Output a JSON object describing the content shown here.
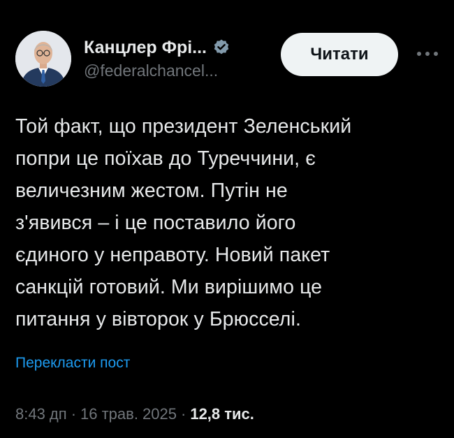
{
  "author": {
    "display_name": "Канцлер Фрі...",
    "handle": "@federalchancel...",
    "verified_icon": "verified-badge-icon",
    "avatar_icon": "profile-photo"
  },
  "actions": {
    "follow_label": "Читати",
    "more_icon": "more-horizontal-icon"
  },
  "tweet": {
    "lines": [
      "Той факт, що президент Зеленський",
      "попри це поїхав до Туреччини, є",
      "величезним жестом. Путін не",
      "з'явився – і це поставило його",
      "єдиного у неправоту. Новий пакет",
      "санкцій готовий. Ми вирішимо це",
      "питання у вівторок у Брюсселі."
    ],
    "translate_label": "Перекласти пост"
  },
  "meta": {
    "time": "8:43 дп",
    "separator": "·",
    "date": "16 трав. 2025",
    "views": "12,8 тис."
  },
  "colors": {
    "background": "#000000",
    "text": "#e7e9ea",
    "secondary": "#71767b",
    "link": "#1d9bf0",
    "button_bg": "#eff3f4"
  }
}
